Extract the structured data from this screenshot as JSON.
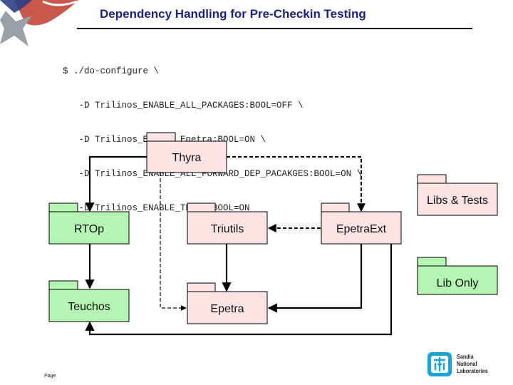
{
  "slide": {
    "title": "Dependency Handling for Pre-Checkin Testing",
    "footer_label": "Page"
  },
  "command": {
    "lines": [
      "$ ./do-configure \\",
      "   -D Trilinos_ENABLE_ALL_PACKAGES:BOOL=OFF \\",
      "   -D Trilinos_ENABLE_Epetra:BOOL=ON \\",
      "   -D Trilinos_ENABLE_ALL_FORWARD_DEP_PACAKGES:BOOL=ON \\",
      "   -D Trilinos_ENABLE_TESTS:BOOL=ON"
    ]
  },
  "colors": {
    "libs_and_tests": "#fde4e4",
    "lib_only": "#b4f5b4",
    "title": "#1a237e"
  },
  "diagram": {
    "packages": {
      "thyra": {
        "label": "Thyra",
        "kind": "libs_and_tests"
      },
      "rtop": {
        "label": "RTOp",
        "kind": "lib_only"
      },
      "triutils": {
        "label": "Triutils",
        "kind": "libs_and_tests"
      },
      "epetraext": {
        "label": "EpetraExt",
        "kind": "libs_and_tests"
      },
      "teuchos": {
        "label": "Teuchos",
        "kind": "lib_only"
      },
      "epetra": {
        "label": "Epetra",
        "kind": "libs_and_tests"
      }
    },
    "legend": {
      "libs_and_tests": "Libs & Tests",
      "lib_only": "Lib Only"
    },
    "edges": [
      {
        "from": "Thyra",
        "to": "RTOp",
        "style": "solid"
      },
      {
        "from": "Thyra",
        "to": "EpetraExt",
        "style": "dashed"
      },
      {
        "from": "Thyra",
        "to": "Epetra",
        "style": "dashed"
      },
      {
        "from": "RTOp",
        "to": "Teuchos",
        "style": "solid"
      },
      {
        "from": "EpetraExt",
        "to": "Triutils",
        "style": "dashed"
      },
      {
        "from": "Triutils",
        "to": "Epetra",
        "style": "solid"
      },
      {
        "from": "EpetraExt",
        "to": "Epetra",
        "style": "solid"
      },
      {
        "from": "EpetraExt",
        "to": "Teuchos",
        "style": "solid"
      }
    ]
  },
  "logo": {
    "line1": "Sandia",
    "line2": "National",
    "line3": "Laboratories"
  }
}
